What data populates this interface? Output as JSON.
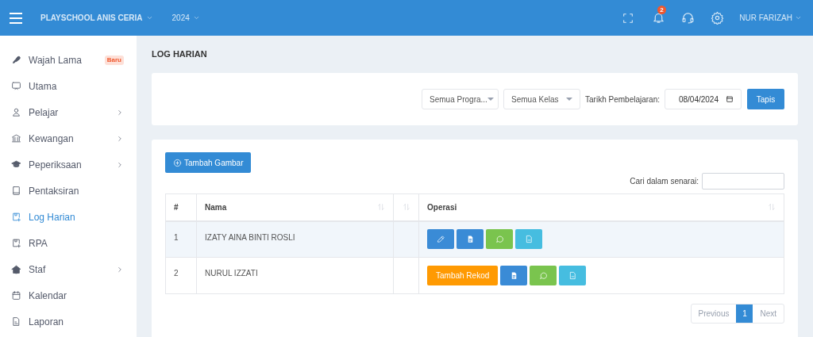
{
  "header": {
    "org": "PLAYSCHOOL ANIS CERIA",
    "year": "2024",
    "notification_count": "2",
    "user": "NUR FARIZAH"
  },
  "sidebar": {
    "items": [
      {
        "label": "Wajah Lama",
        "badge": "Baru",
        "has_submenu": false,
        "selected": false
      },
      {
        "label": "Utama",
        "has_submenu": false,
        "selected": false
      },
      {
        "label": "Pelajar",
        "has_submenu": true,
        "selected": false
      },
      {
        "label": "Kewangan",
        "has_submenu": true,
        "selected": false
      },
      {
        "label": "Peperiksaan",
        "has_submenu": true,
        "selected": false
      },
      {
        "label": "Pentaksiran",
        "has_submenu": false,
        "selected": false
      },
      {
        "label": "Log Harian",
        "has_submenu": false,
        "selected": true
      },
      {
        "label": "RPA",
        "has_submenu": false,
        "selected": false
      },
      {
        "label": "Staf",
        "has_submenu": true,
        "selected": false
      },
      {
        "label": "Kalendar",
        "has_submenu": false,
        "selected": false
      },
      {
        "label": "Laporan",
        "has_submenu": false,
        "selected": false
      }
    ]
  },
  "page_title": "LOG HARIAN",
  "filters": {
    "program": "Semua Progra...",
    "class": "Semua Kelas",
    "date_label": "Tarikh Pembelajaran:",
    "date": "08/04/2024",
    "button": "Tapis"
  },
  "add_button": "Tambah Gambar",
  "search_label": "Cari dalam senarai:",
  "table": {
    "columns": [
      {
        "label": "#",
        "sortable": false
      },
      {
        "label": "Nama",
        "sortable": true
      },
      {
        "sortable": true
      },
      {
        "label": "Operasi",
        "sortable": true
      }
    ],
    "rows": [
      {
        "no": "1",
        "name": "IZATY AINA BINTI ROSLI",
        "highlighted": true,
        "actions": [
          {
            "kind": "edit"
          },
          {
            "kind": "report"
          },
          {
            "kind": "whatsapp"
          },
          {
            "kind": "document"
          }
        ]
      },
      {
        "no": "2",
        "name": "NURUL IZZATI",
        "highlighted": false,
        "actions": [
          {
            "kind": "add",
            "label": "Tambah Rekod"
          },
          {
            "kind": "report"
          },
          {
            "kind": "whatsapp"
          },
          {
            "kind": "document"
          }
        ]
      }
    ]
  },
  "pagination": {
    "previous": "Previous",
    "pages": [
      {
        "label": "1",
        "selected": true
      }
    ],
    "next": "Next"
  }
}
